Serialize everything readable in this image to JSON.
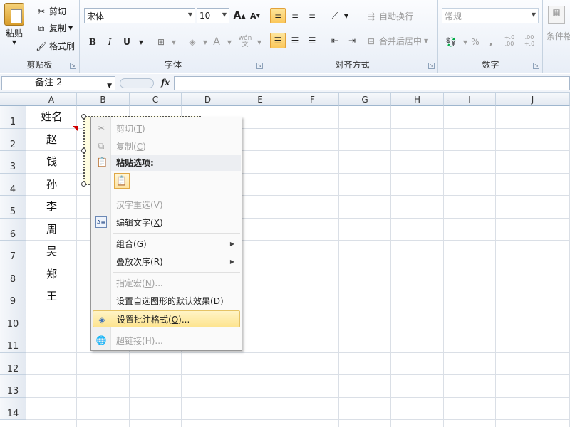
{
  "clipboard": {
    "paste_label": "粘贴",
    "cut_label": "剪切",
    "copy_label": "复制",
    "format_painter_label": "格式刷",
    "group_label": "剪贴板"
  },
  "font": {
    "font_name": "宋体",
    "font_size": "10",
    "bold": "B",
    "italic": "I",
    "underline": "U",
    "grow": "A",
    "shrink": "A",
    "font_color": "A",
    "phonetic": "wén",
    "group_label": "字体"
  },
  "alignment": {
    "wrap_label": "自动换行",
    "merge_label": "合并后居中",
    "group_label": "对齐方式"
  },
  "number": {
    "format_value": "常规",
    "percent": "%",
    "comma": ",",
    "inc_decimal": "+.0 .00",
    "dec_decimal": ".00 +.0",
    "group_label": "数字"
  },
  "styles": {
    "conditional_label": "条件格"
  },
  "formula_bar": {
    "name_box": "备注 2",
    "fx": "fx"
  },
  "columns": [
    "A",
    "B",
    "C",
    "D",
    "E",
    "F",
    "G",
    "H",
    "I",
    "J"
  ],
  "rows": [
    "1",
    "2",
    "3",
    "4",
    "5",
    "6",
    "7",
    "8",
    "9",
    "10",
    "11",
    "12",
    "13",
    "14"
  ],
  "cells_a": [
    "姓名",
    "赵",
    "钱",
    "孙",
    "李",
    "周",
    "吴",
    "郑",
    "王"
  ],
  "context_menu": {
    "cut": "剪切",
    "cut_key": "T",
    "copy": "复制",
    "copy_key": "C",
    "paste_options": "粘贴选项:",
    "reconvert": "汉字重选",
    "reconvert_key": "V",
    "edit_text": "编辑文字",
    "edit_text_key": "X",
    "group": "组合",
    "group_key": "G",
    "order": "叠放次序",
    "order_key": "R",
    "assign_macro": "指定宏",
    "assign_macro_key": "N",
    "assign_macro_suffix": "...",
    "set_default": "设置自选图形的默认效果",
    "set_default_key": "D",
    "format_comment": "设置批注格式",
    "format_comment_key": "O",
    "format_comment_suffix": "...",
    "hyperlink": "超链接",
    "hyperlink_key": "H",
    "hyperlink_suffix": "..."
  },
  "colors": {
    "highlight": "#fde48f",
    "comment_indicator": "#d00000",
    "ribbon_bg": "#e8eef7"
  }
}
